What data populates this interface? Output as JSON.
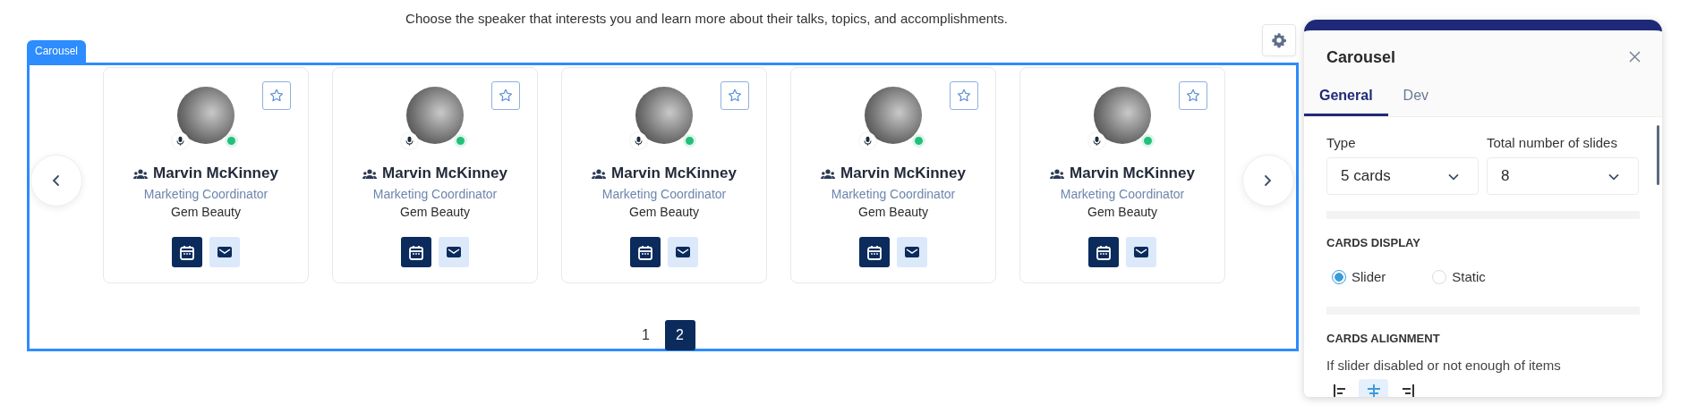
{
  "description": "Choose the speaker that interests you and learn more about their talks, topics, and accomplishments.",
  "carousel": {
    "label": "Carousel",
    "cards": [
      {
        "name": "Marvin McKinney",
        "role": "Marketing Coordinator",
        "company": "Gem Beauty",
        "favorite": false,
        "online": true
      },
      {
        "name": "Marvin McKinney",
        "role": "Marketing Coordinator",
        "company": "Gem Beauty",
        "favorite": false,
        "online": true
      },
      {
        "name": "Marvin McKinney",
        "role": "Marketing Coordinator",
        "company": "Gem Beauty",
        "favorite": false,
        "online": true
      },
      {
        "name": "Marvin McKinney",
        "role": "Marketing Coordinator",
        "company": "Gem Beauty",
        "favorite": false,
        "online": true
      },
      {
        "name": "Marvin McKinney",
        "role": "Marketing Coordinator",
        "company": "Gem Beauty",
        "favorite": false,
        "online": true
      }
    ],
    "pages": [
      {
        "label": "1",
        "selected": false
      },
      {
        "label": "2",
        "selected": true
      }
    ]
  },
  "panel": {
    "title": "Carousel",
    "tabs": [
      {
        "label": "General",
        "selected": true
      },
      {
        "label": "Dev",
        "selected": false
      }
    ],
    "type": {
      "label": "Type",
      "value": "5 cards"
    },
    "total_slides": {
      "label": "Total number of slides",
      "value": "8"
    },
    "cards_display": {
      "heading": "CARDS DISPLAY",
      "options": [
        {
          "label": "Slider",
          "selected": true
        },
        {
          "label": "Static",
          "selected": false
        }
      ]
    },
    "cards_alignment": {
      "heading": "CARDS ALIGNMENT",
      "hint": "If slider disabled or not enough of items",
      "options": [
        {
          "kind": "left",
          "selected": false
        },
        {
          "kind": "center",
          "selected": true
        },
        {
          "kind": "right",
          "selected": false
        }
      ]
    }
  }
}
